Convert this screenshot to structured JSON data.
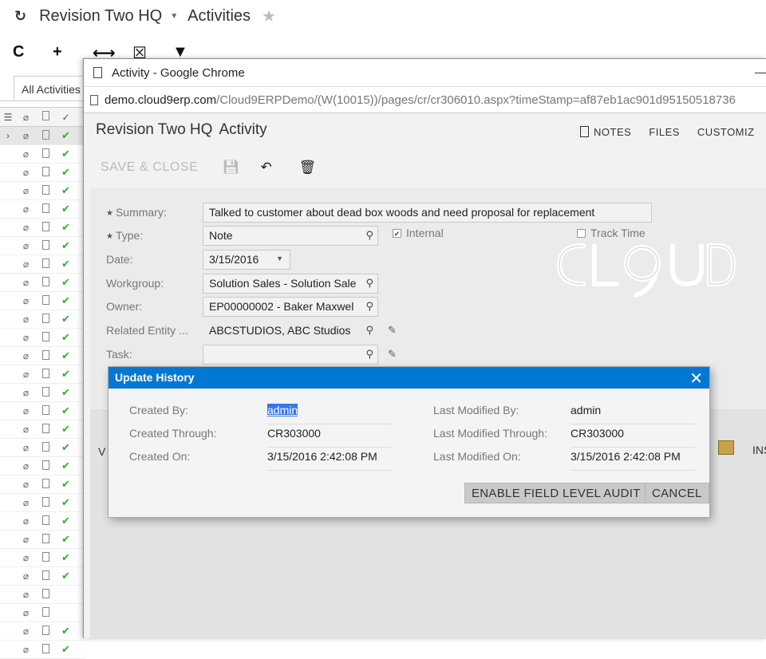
{
  "bg": {
    "title": "Revision Two HQ",
    "subtitle": "Activities",
    "tab": "All Activities",
    "toolbar": [
      "C",
      "+",
      "⟷",
      "☒",
      "▼"
    ],
    "rows": [
      {
        "chk": true,
        "sel": true
      },
      {
        "chk": true
      },
      {
        "chk": true
      },
      {
        "chk": true
      },
      {
        "chk": true
      },
      {
        "chk": true
      },
      {
        "chk": true
      },
      {
        "chk": true
      },
      {
        "chk": true
      },
      {
        "chk": true
      },
      {
        "chk": true
      },
      {
        "chk": true
      },
      {
        "chk": true
      },
      {
        "chk": true
      },
      {
        "chk": true
      },
      {
        "chk": true
      },
      {
        "chk": true
      },
      {
        "chk": true
      },
      {
        "chk": true
      },
      {
        "chk": true
      },
      {
        "chk": true
      },
      {
        "chk": true
      },
      {
        "chk": true
      },
      {
        "chk": true
      },
      {
        "chk": true
      },
      {
        "chk": false
      },
      {
        "chk": false
      },
      {
        "chk": true
      },
      {
        "chk": true
      }
    ]
  },
  "window": {
    "title": "Activity - Google Chrome",
    "url_host": "demo.cloud9erp.com",
    "url_path": "/Cloud9ERPDemo/(W(10015))/pages/cr/cr306010.aspx?timeStamp=af87eb1ac901d95150518736"
  },
  "page": {
    "title": "Revision Two HQ",
    "subtitle": "Activity",
    "links": {
      "notes": "NOTES",
      "files": "FILES",
      "customize": "CUSTOMIZ"
    },
    "save_close": "SAVE & CLOSE"
  },
  "form": {
    "summary_label": "Summary:",
    "summary_value": "Talked to customer about dead box woods and need proposal for replacement",
    "type_label": "Type:",
    "type_value": "Note",
    "internal_label": "Internal",
    "track_time_label": "Track Time",
    "date_label": "Date:",
    "date_value": "3/15/2016",
    "workgroup_label": "Workgroup:",
    "workgroup_value": "Solution Sales - Solution Sale",
    "owner_label": "Owner:",
    "owner_value": "EP00000002 - Baker Maxwel",
    "related_label": "Related Entity ...",
    "related_value": "ABCSTUDIOS, ABC Studios",
    "task_label": "Task:",
    "task_value": "",
    "side_v": "V",
    "side_ins": "INS"
  },
  "modal": {
    "title": "Update History",
    "created_by_label": "Created By:",
    "created_by": "admin",
    "created_through_label": "Created Through:",
    "created_through": "CR303000",
    "created_on_label": "Created On:",
    "created_on": "3/15/2016 2:42:08 PM",
    "modified_by_label": "Last Modified By:",
    "modified_by": "admin",
    "modified_through_label": "Last Modified Through:",
    "modified_through": "CR303000",
    "modified_on_label": "Last Modified On:",
    "modified_on": "3/15/2016 2:42:08 PM",
    "audit_button": "ENABLE FIELD LEVEL AUDIT",
    "cancel_button": "CANCEL"
  },
  "colors": {
    "accent": "#0078d4",
    "check": "#3aa63a",
    "highlight": "#3377ee"
  }
}
